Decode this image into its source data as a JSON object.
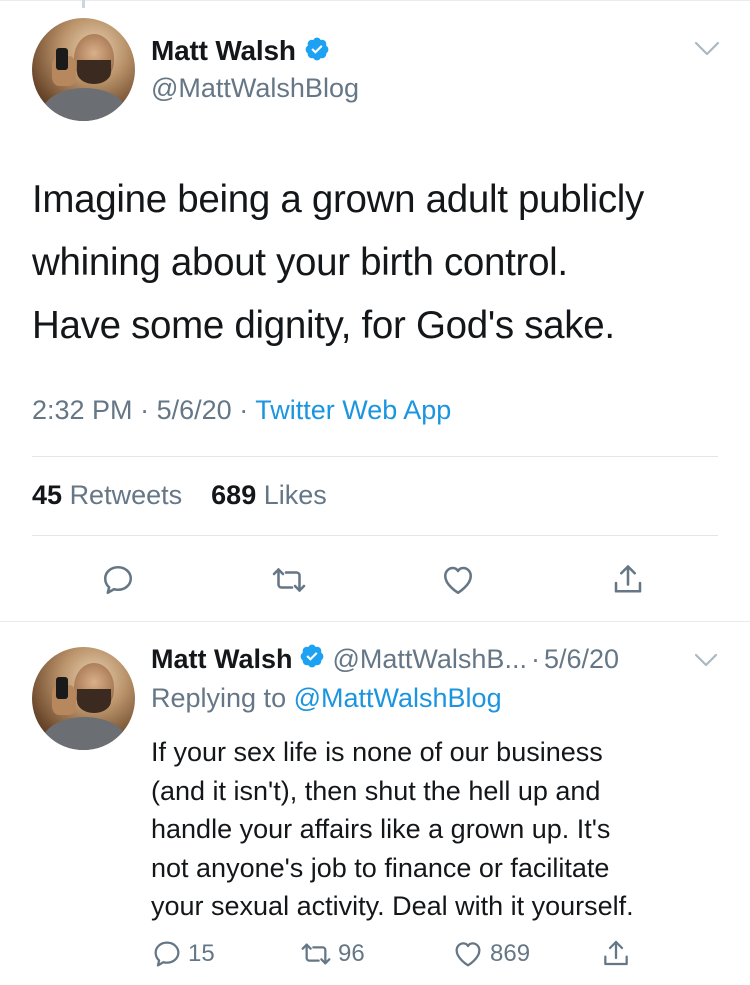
{
  "main_tweet": {
    "author_name": "Matt Walsh",
    "handle": "@MattWalshBlog",
    "verified": true,
    "text_lines": [
      "Imagine being a grown adult publicly",
      "whining about your birth control.",
      "Have some dignity, for God's sake."
    ],
    "time": "2:32 PM",
    "separator": "·",
    "date": "5/6/20",
    "source": "Twitter Web App",
    "retweets_count": "45",
    "retweets_label": "Retweets",
    "likes_count": "689",
    "likes_label": "Likes",
    "actions": [
      "reply-icon",
      "retweet-icon",
      "like-icon",
      "share-icon"
    ]
  },
  "reply_tweet": {
    "author_name": "Matt Walsh",
    "verified": true,
    "handle_truncated": "@MattWalshB...",
    "separator": "·",
    "date": "5/6/20",
    "replying_prefix": "Replying to",
    "replying_to": "@MattWalshBlog",
    "text_lines": [
      "If your sex life is none of our business",
      "(and it isn't), then shut the hell up and",
      "handle your affairs like a grown up. It's",
      "not anyone's job to finance or facilitate",
      "your sexual activity. Deal with it yourself."
    ],
    "reply_count": "15",
    "retweet_count": "96",
    "like_count": "869"
  },
  "colors": {
    "text": "#14171a",
    "secondary": "#657786",
    "link": "#1b95e0",
    "verified": "#1da1f2",
    "divider": "#e1e8ed"
  }
}
